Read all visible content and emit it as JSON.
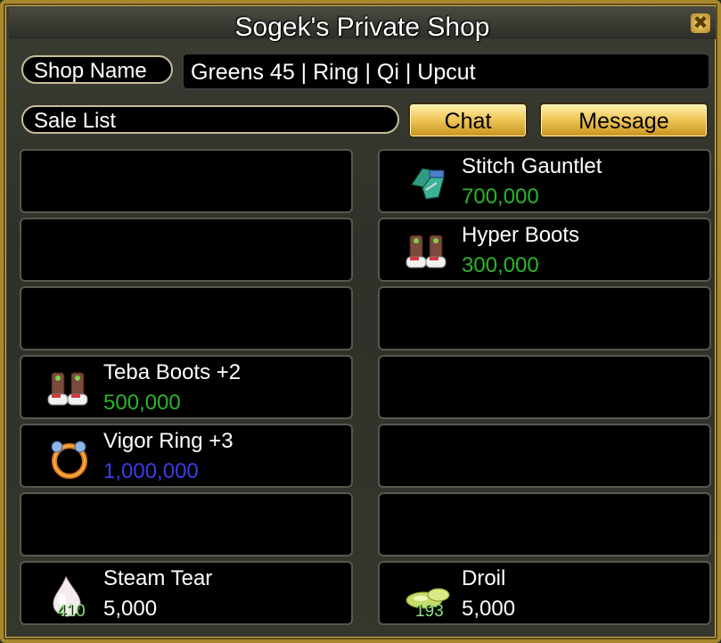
{
  "window": {
    "title": "Sogek's Private Shop",
    "close_glyph": "✖"
  },
  "shop_name": {
    "label": "Shop Name",
    "value": "Greens 45 | Ring | Qi | Upcut"
  },
  "sale_list": {
    "label": "Sale List"
  },
  "buttons": {
    "chat": "Chat",
    "message": "Message"
  },
  "colors": {
    "price_green": "#2ab52a",
    "price_blue": "#3c3ce6",
    "price_white": "#ffffff",
    "frame_gold": "#c9a23a"
  },
  "slots": {
    "left": [
      {
        "empty": true
      },
      {
        "empty": true
      },
      {
        "empty": true
      },
      {
        "name": "Teba Boots +2",
        "price": "500,000",
        "price_color": "green",
        "icon": "boots-icon"
      },
      {
        "name": "Vigor Ring +3",
        "price": "1,000,000",
        "price_color": "blue",
        "icon": "ring-icon"
      },
      {
        "empty": true
      },
      {
        "name": "Steam Tear",
        "price": "5,000",
        "price_color": "white",
        "icon": "tear-icon",
        "quantity": "410"
      }
    ],
    "right": [
      {
        "name": "Stitch Gauntlet",
        "price": "700,000",
        "price_color": "green",
        "icon": "gauntlet-icon"
      },
      {
        "name": "Hyper Boots",
        "price": "300,000",
        "price_color": "green",
        "icon": "boots-icon"
      },
      {
        "empty": true
      },
      {
        "empty": true
      },
      {
        "empty": true
      },
      {
        "empty": true
      },
      {
        "name": "Droil",
        "price": "5,000",
        "price_color": "white",
        "icon": "droil-icon",
        "quantity": "193"
      }
    ]
  }
}
